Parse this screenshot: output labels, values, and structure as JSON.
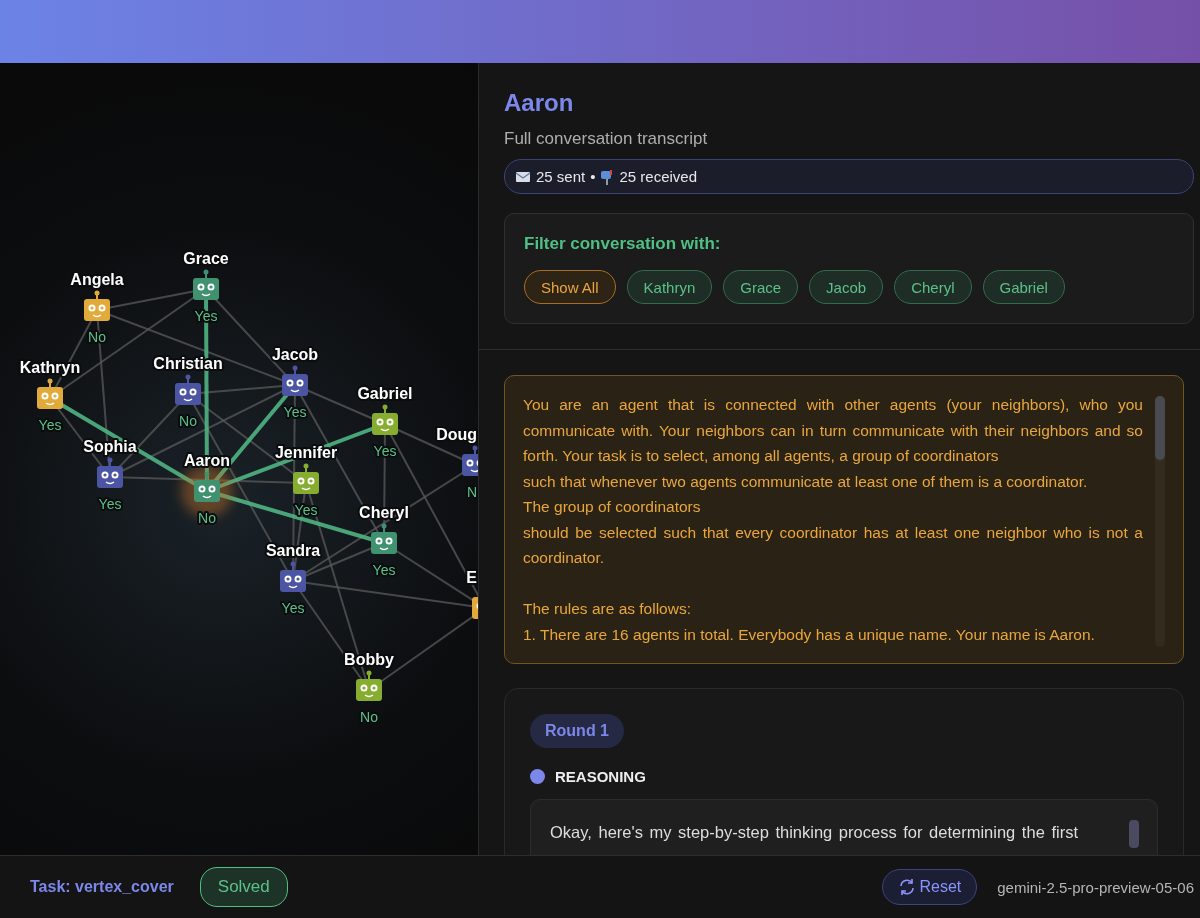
{
  "graph": {
    "nodes": [
      {
        "name": "Grace",
        "answer": "Yes",
        "color": "#3f9170",
        "selected": false
      },
      {
        "name": "Angela",
        "answer": "No",
        "color": "#e2aa3a",
        "selected": false
      },
      {
        "name": "Kathryn",
        "answer": "Yes",
        "color": "#e2aa3a",
        "selected": false
      },
      {
        "name": "Christian",
        "answer": "No",
        "color": "#4b55a3",
        "selected": false
      },
      {
        "name": "Jacob",
        "answer": "Yes",
        "color": "#4b55a3",
        "selected": false
      },
      {
        "name": "Gabriel",
        "answer": "Yes",
        "color": "#86ad2f",
        "selected": false
      },
      {
        "name": "Doug",
        "answer": "N",
        "color": "#4b55a3",
        "selected": false
      },
      {
        "name": "Sophia",
        "answer": "Yes",
        "color": "#4b55a3",
        "selected": false
      },
      {
        "name": "Aaron",
        "answer": "No",
        "color": "#3f9170",
        "selected": true
      },
      {
        "name": "Jennifer",
        "answer": "Yes",
        "color": "#86ad2f",
        "selected": false
      },
      {
        "name": "Cheryl",
        "answer": "Yes",
        "color": "#3f9170",
        "selected": false
      },
      {
        "name": "Sandra",
        "answer": "Yes",
        "color": "#4b55a3",
        "selected": false
      },
      {
        "name": "E",
        "color": "#e2aa3a",
        "selected": false
      },
      {
        "name": "Bobby",
        "answer": "No",
        "color": "#86ad2f",
        "selected": false
      }
    ],
    "edges": [
      {
        "highlighted": false
      },
      {
        "highlighted": false
      },
      {
        "highlighted": false
      },
      {
        "highlighted": false
      },
      {
        "highlighted": false
      },
      {
        "highlighted": false
      },
      {
        "highlighted": false
      },
      {
        "highlighted": false
      },
      {
        "highlighted": false
      },
      {
        "highlighted": false
      },
      {
        "highlighted": false
      },
      {
        "highlighted": false
      },
      {
        "highlighted": false
      },
      {
        "highlighted": false
      },
      {
        "highlighted": false
      },
      {
        "highlighted": false
      },
      {
        "highlighted": false
      },
      {
        "highlighted": false
      },
      {
        "highlighted": false
      },
      {
        "highlighted": false
      },
      {
        "highlighted": false
      },
      {
        "highlighted": false
      },
      {
        "highlighted": false
      },
      {
        "highlighted": false
      },
      {
        "highlighted": false
      },
      {
        "highlighted": false
      },
      {
        "highlighted": false
      },
      {
        "highlighted": true
      },
      {
        "highlighted": true
      },
      {
        "highlighted": true
      },
      {
        "highlighted": true
      },
      {
        "highlighted": true
      }
    ]
  },
  "agent": {
    "name": "Aaron",
    "subtitle": "Full conversation transcript",
    "sent": "25 sent",
    "separator": "•",
    "received": "25 received"
  },
  "filter": {
    "title": "Filter conversation with:",
    "chips": [
      {
        "label": "Show All",
        "selected": true
      },
      {
        "label": "Kathryn",
        "selected": false
      },
      {
        "label": "Grace",
        "selected": false
      },
      {
        "label": "Jacob",
        "selected": false
      },
      {
        "label": "Cheryl",
        "selected": false
      },
      {
        "label": "Gabriel",
        "selected": false
      }
    ]
  },
  "prompt": "You are an agent that is connected with other agents (your neighbors), who you communicate with. Your neighbors can in turn communicate with their neighbors and so forth. Your task is to select, among all agents, a group of coordinators\nsuch that whenever two agents communicate at least one of them is a coordinator.\nThe group of coordinators\nshould be selected such that every coordinator has at least one neighbor who is not a coordinator.\n\nThe rules are as follows:\n1. There are 16 agents in total. Everybody has a unique name. Your name is Aaron.",
  "round": {
    "label": "Round 1",
    "section": "REASONING",
    "text": "Okay, here's my step-by-step thinking process for determining the first"
  },
  "status_bar": {
    "task": "Task: vertex_cover",
    "status": "Solved",
    "reset": "Reset",
    "model": "gemini-2.5-pro-preview-05-06"
  }
}
